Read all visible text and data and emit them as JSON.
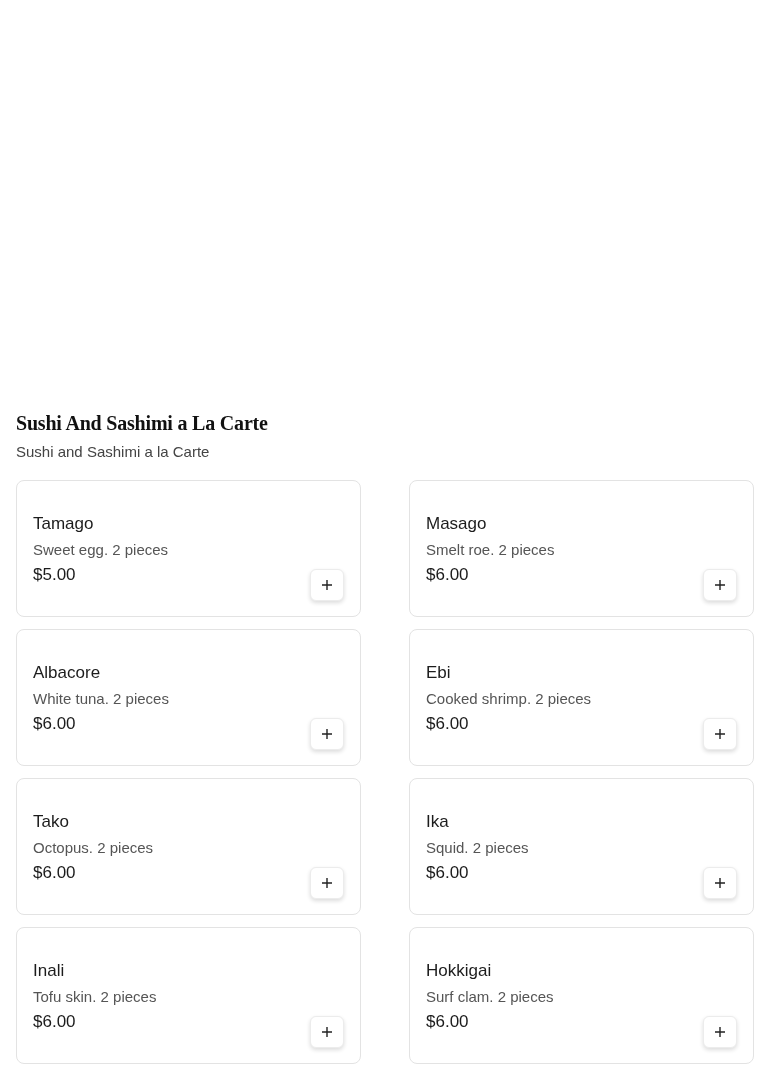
{
  "section": {
    "title": "Sushi And Sashimi a La Carte",
    "subtitle": "Sushi and Sashimi a la Carte"
  },
  "items": [
    {
      "name": "Tamago",
      "description": "Sweet egg. 2 pieces",
      "price": "$5.00"
    },
    {
      "name": "Masago",
      "description": "Smelt roe. 2 pieces",
      "price": "$6.00"
    },
    {
      "name": "Albacore",
      "description": "White tuna. 2 pieces",
      "price": "$6.00"
    },
    {
      "name": "Ebi",
      "description": "Cooked shrimp. 2 pieces",
      "price": "$6.00"
    },
    {
      "name": "Tako",
      "description": "Octopus. 2 pieces",
      "price": "$6.00"
    },
    {
      "name": "Ika",
      "description": "Squid. 2 pieces",
      "price": "$6.00"
    },
    {
      "name": "Inali",
      "description": "Tofu skin. 2 pieces",
      "price": "$6.00"
    },
    {
      "name": "Hokkigai",
      "description": "Surf clam. 2 pieces",
      "price": "$6.00"
    }
  ]
}
